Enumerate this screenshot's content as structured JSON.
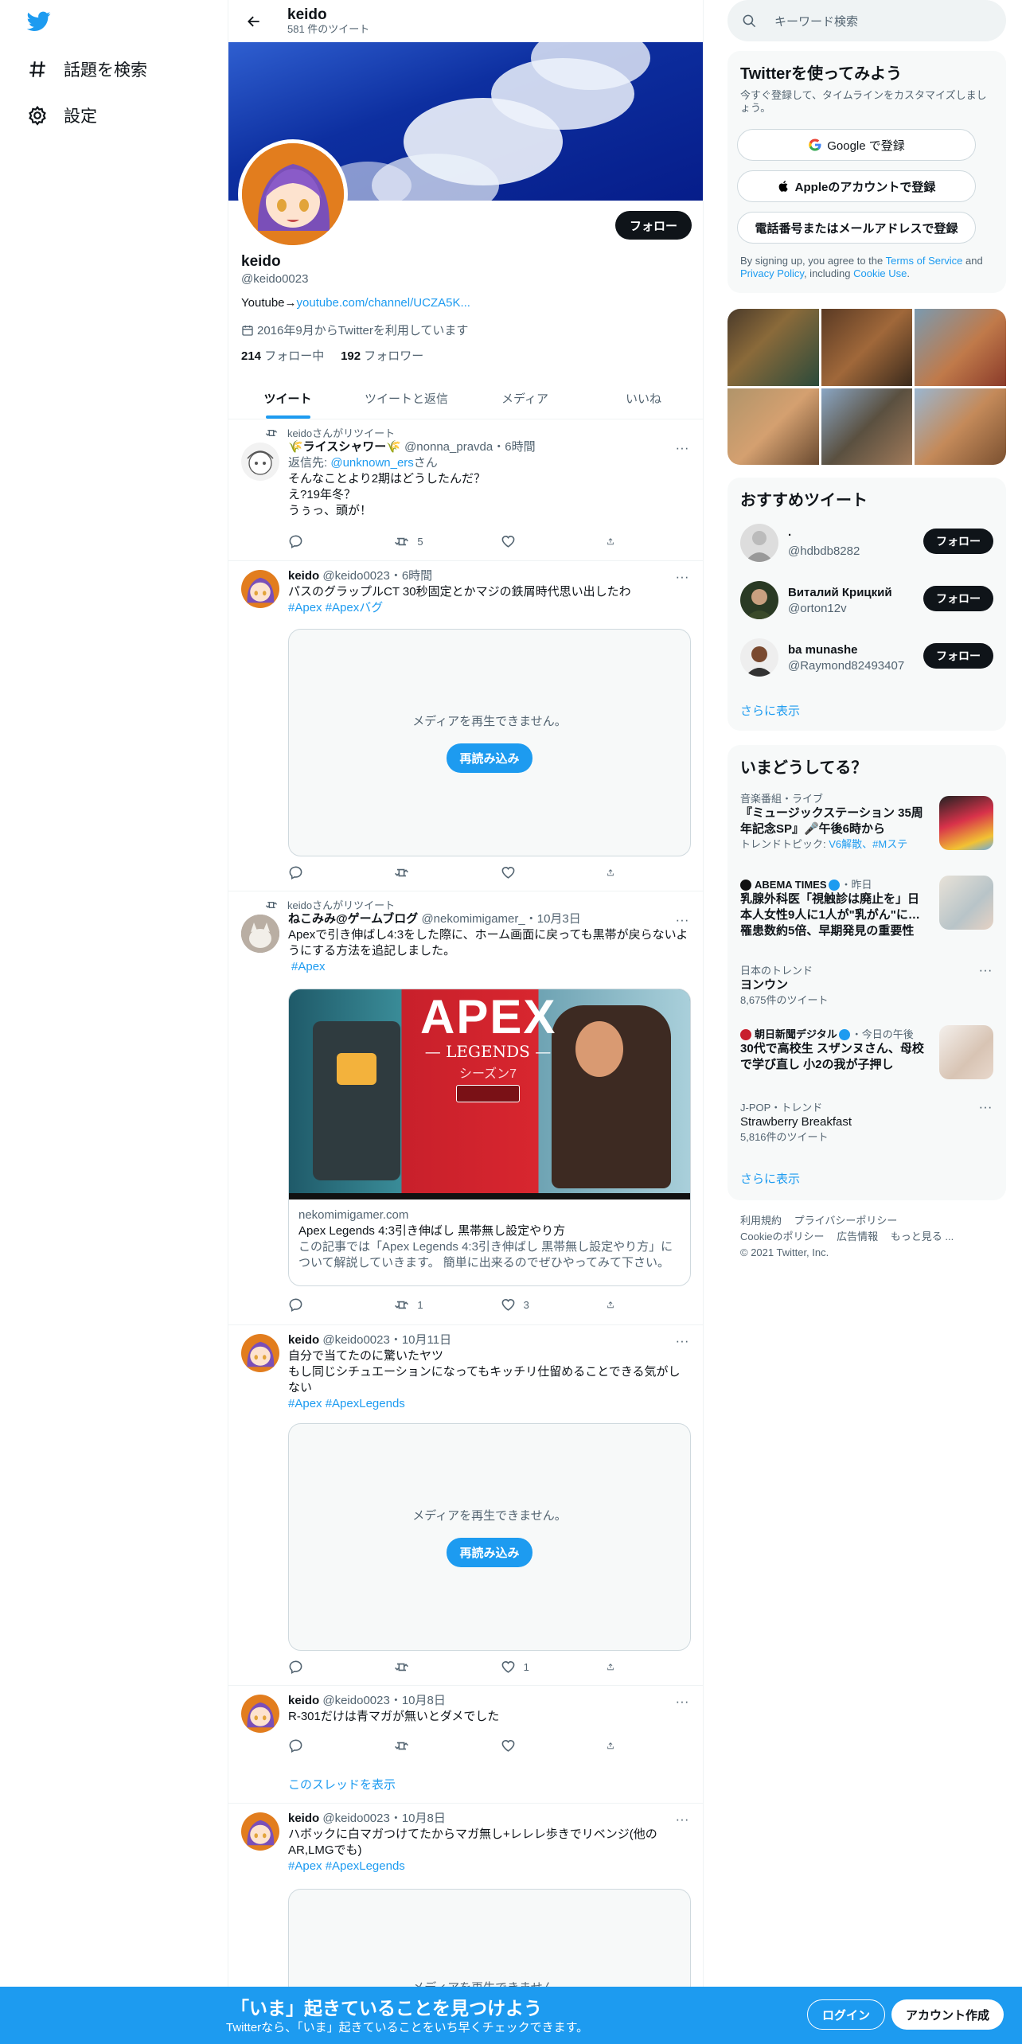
{
  "nav": {
    "explore": "話題を検索",
    "settings": "設定"
  },
  "header": {
    "name": "keido",
    "tweet_count": "581 件のツイート"
  },
  "profile": {
    "name": "keido",
    "handle": "@keido0023",
    "bio_prefix": "Youtube→",
    "bio_link": "youtube.com/channel/UCZA5K...",
    "joined": "2016年9月からTwitterを利用しています",
    "following_count": "214",
    "following_label": "フォロー中",
    "followers_count": "192",
    "followers_label": "フォロワー",
    "follow_button": "フォロー"
  },
  "tabs": [
    "ツイート",
    "ツイートと返信",
    "メディア",
    "いいね"
  ],
  "media_error": {
    "message": "メディアを再生できません。",
    "reload": "再読み込み"
  },
  "tweets": [
    {
      "retweet_label": "keidoさんがリツイート",
      "name": "🌾ライスシャワー🌾",
      "handle": "@nonna_pravda",
      "time": "・6時間",
      "reply_prefix": "返信先: ",
      "reply_to": "@unknown_ers",
      "reply_suffix": "さん",
      "lines": [
        "そんなことより2期はどうしたんだ？",
        "え?19年冬？",
        "うぅっ、頭が！"
      ],
      "retweets": "5"
    },
    {
      "name": "keido",
      "handle": "@keido0023",
      "time": "・6時間",
      "text": "パスのグラップルCT 30秒固定とかマジの鉄屑時代思い出したわ",
      "tags": "#Apex #Apexバグ"
    },
    {
      "retweet_label": "keidoさんがリツイート",
      "name": "ねこみみ@ゲームブログ",
      "handle": "@nekomimigamer_",
      "time": "・10月3日",
      "text": "Apexで引き伸ばし4:3をした際に、ホーム画面に戻っても黒帯が戻らないようにする方法を追記しました。",
      "tags": "#Apex",
      "card_domain": "nekomimigamer.com",
      "card_title": "Apex Legends 4:3引き伸ばし 黒帯無し設定やり方",
      "card_desc": "この記事では「Apex Legends 4:3引き伸ばし 黒帯無し設定やり方」について解説していきます。 簡単に出来るのでぜひやってみて下さい。",
      "card_image_title": "APEX",
      "card_image_sub": "— LEGENDS —",
      "card_image_season": "シーズン7",
      "retweets": "1",
      "likes": "3"
    },
    {
      "name": "keido",
      "handle": "@keido0023",
      "time": "・10月11日",
      "lines": [
        "自分で当てたのに驚いたヤツ",
        "もし同じシチュエーションになってもキッチリ仕留めることできる気がしない"
      ],
      "tags": "#Apex #ApexLegends",
      "likes": "1"
    },
    {
      "name": "keido",
      "handle": "@keido0023",
      "time": "・10月8日",
      "text": "R-301だけは青マガが無いとダメでした",
      "thread_link": "このスレッドを表示"
    },
    {
      "name": "keido",
      "handle": "@keido0023",
      "time": "・10月8日",
      "text": "ハボックに白マガつけてたからマガ無し+レレレ歩きでリベンジ(他のAR,LMGでも)",
      "tags": "#Apex #ApexLegends"
    }
  ],
  "right": {
    "search_placeholder": "キーワード検索",
    "signup": {
      "title": "Twitterを使ってみよう",
      "subtitle": "今すぐ登録して、タイムラインをカスタマイズしましょう。",
      "google": "Google で登録",
      "apple": "Appleのアカウントで登録",
      "phone": "電話番号またはメールアドレスで登録",
      "terms_prefix": "By signing up, you agree to the ",
      "terms": "Terms of Service",
      "and": " and ",
      "privacy": "Privacy Policy",
      "including": ", including ",
      "cookie": "Cookie Use",
      "period": "."
    },
    "who_to_follow": {
      "title": "おすすめツイート",
      "users": [
        {
          "name": "·",
          "handle": "@hdbdb8282"
        },
        {
          "name": "Виталий Крицкий",
          "handle": "@orton12v"
        },
        {
          "name": "ba munashe",
          "handle": "@Raymond82493407"
        }
      ],
      "follow": "フォロー",
      "more": "さらに表示"
    },
    "trends": {
      "title": "いまどうしてる？",
      "items": [
        {
          "context": "音楽番組・ライブ",
          "headline": "『ミュージックステーション 35周年記念SP』🎤午後6時から",
          "topics_prefix": "トレンドトピック: ",
          "topics": "V6解散、#Mステ"
        },
        {
          "source": "ABEMA TIMES",
          "time": "・昨日",
          "headline": "乳腺外科医「視触診は廃止を」日本人女性9人に1人が\"乳がん\"に…罹患数約5倍、早期発見の重要性"
        },
        {
          "context": "日本のトレンド",
          "headline": "ヨンウン",
          "count": "8,675件のツイート"
        },
        {
          "source": "朝日新聞デジタル",
          "time": "・今日の午後",
          "headline": "30代で高校生 スザンヌさん、母校で学び直し 小2の我が子押し"
        },
        {
          "context": "J-POP・トレンド",
          "headline": "Strawberry Breakfast",
          "count": "5,816件のツイート"
        }
      ],
      "more": "さらに表示"
    },
    "footer": {
      "links": [
        "利用規約",
        "プライバシーポリシー",
        "Cookieのポリシー",
        "広告情報",
        "もっと見る ..."
      ],
      "copyright": "© 2021 Twitter, Inc."
    }
  },
  "bottom": {
    "title": "「いま」起きていることを見つけよう",
    "subtitle": "Twitterなら、「いま」起きていることをいち早くチェックできます。",
    "login": "ログイン",
    "signup": "アカウント作成"
  },
  "colors": {
    "accent": "#1d9bf0",
    "text": "#0f1419",
    "muted": "#536471",
    "border": "#eff3f4"
  }
}
